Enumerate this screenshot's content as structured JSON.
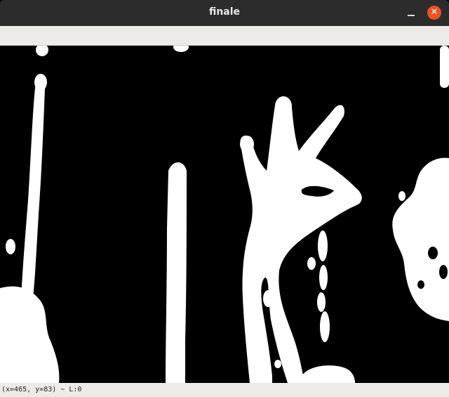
{
  "window": {
    "title": "finale"
  },
  "titlebar": {
    "minimize_icon": "minimize-icon",
    "close_icon": "close-icon",
    "close_glyph": "✕",
    "close_color": "#e95420"
  },
  "statusbar": {
    "coords": "(x=465, y=83) ~",
    "level": "L:0"
  }
}
